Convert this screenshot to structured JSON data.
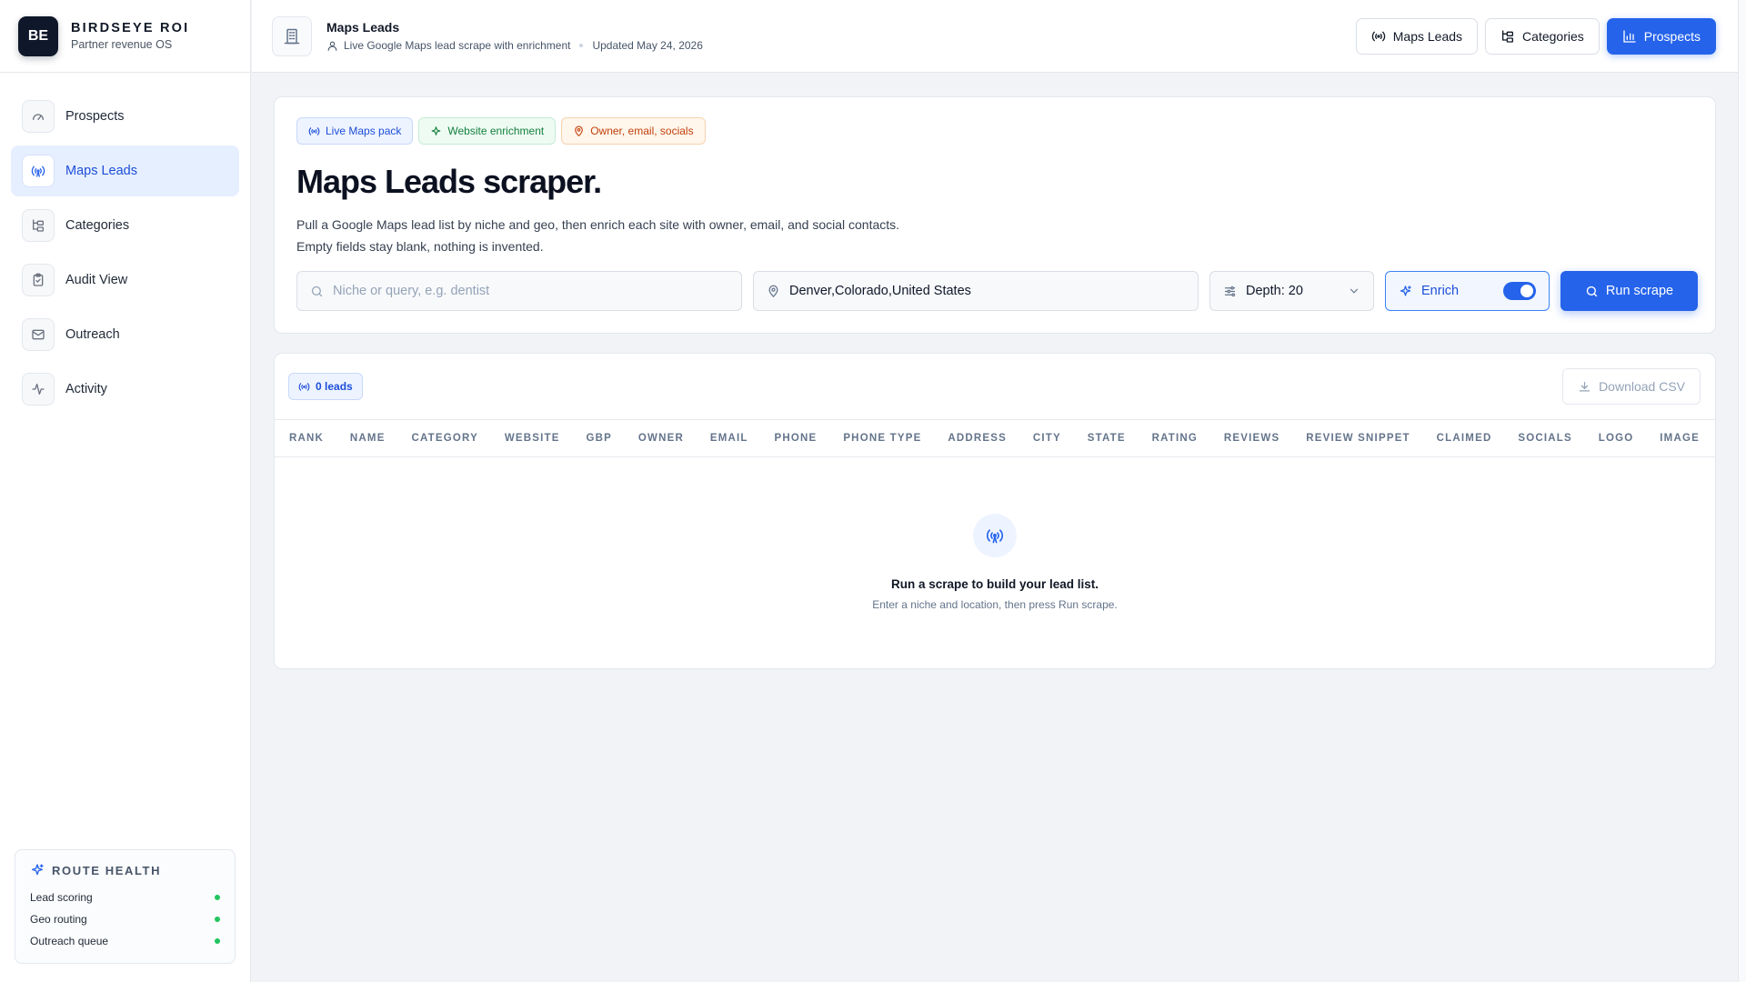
{
  "brand": {
    "mark": "BE",
    "name": "BIRDSEYE ROI",
    "subtitle": "Partner revenue OS"
  },
  "sidebar": {
    "items": [
      {
        "label": "Prospects",
        "icon": "gauge-icon",
        "active": false
      },
      {
        "label": "Maps Leads",
        "icon": "radio-tower-icon",
        "active": true
      },
      {
        "label": "Categories",
        "icon": "folder-tree-icon",
        "active": false
      },
      {
        "label": "Audit View",
        "icon": "clipboard-check-icon",
        "active": false
      },
      {
        "label": "Outreach",
        "icon": "mail-icon",
        "active": false
      },
      {
        "label": "Activity",
        "icon": "activity-icon",
        "active": false
      }
    ],
    "health": {
      "title": "ROUTE HEALTH",
      "rows": [
        {
          "label": "Lead scoring",
          "status": "ok"
        },
        {
          "label": "Geo routing",
          "status": "ok"
        },
        {
          "label": "Outreach queue",
          "status": "ok"
        }
      ]
    }
  },
  "header": {
    "title": "Maps Leads",
    "meta": "Live Google Maps lead scrape with enrichment",
    "updated": "Updated May 24, 2026",
    "actions": [
      {
        "label": "Maps Leads",
        "icon": "radio-tower-icon"
      },
      {
        "label": "Categories",
        "icon": "folder-tree-icon"
      },
      {
        "label": "Prospects",
        "icon": "bar-chart-icon"
      }
    ]
  },
  "hero": {
    "chips": [
      "Live Maps pack",
      "Website enrichment",
      "Owner, email, socials"
    ],
    "title": "Maps Leads scraper.",
    "desc_line1": "Pull a Google Maps lead list by niche and geo, then enrich each site with owner, email, and social contacts.",
    "desc_line2": "Empty fields stay blank, nothing is invented.",
    "niche_placeholder": "Niche or query, e.g. dentist",
    "location_value": "Denver,Colorado,United States",
    "depth_label": "Depth: 20",
    "enrich_label": "Enrich",
    "enrich_on": true,
    "run_label": "Run scrape"
  },
  "results": {
    "count_label": "0 leads",
    "download_label": "Download CSV",
    "columns": [
      "RANK",
      "NAME",
      "CATEGORY",
      "WEBSITE",
      "GBP",
      "OWNER",
      "EMAIL",
      "PHONE",
      "PHONE TYPE",
      "ADDRESS",
      "CITY",
      "STATE",
      "RATING",
      "REVIEWS",
      "REVIEW SNIPPET",
      "CLAIMED",
      "SOCIALS",
      "LOGO",
      "IMAGE"
    ],
    "empty_title": "Run a scrape to build your lead list.",
    "empty_sub": "Enter a niche and location, then press Run scrape."
  },
  "colors": {
    "accent": "#2563eb",
    "success": "#22c55e",
    "brand_dark": "#0f172a"
  }
}
